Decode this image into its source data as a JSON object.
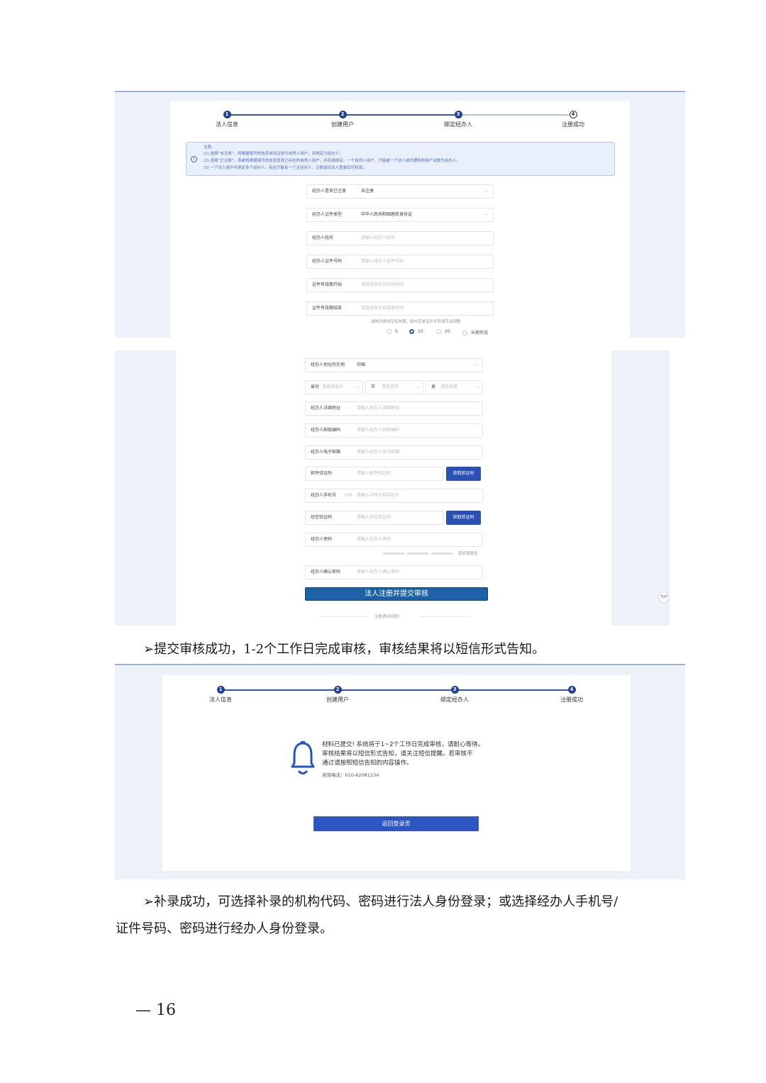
{
  "steps": [
    "法人信息",
    "创建用户",
    "绑定经办人",
    "注册成功"
  ],
  "step_numbers": [
    "1",
    "2",
    "3",
    "4"
  ],
  "notice": {
    "title": "注意:",
    "lines": [
      "(1) 选择“未注册”，将根据填写的信息自动注册为自然人用户，并绑定为经办人；",
      "(2) 选择“已注册”，系统将根据填写的信息查找已存在的自然人用户，并完成绑定。一个自然人用户，只能被一个法人或代理机构用户关联为经办人。",
      "(3) 一个法人用户可绑定多个经办人，有且只能有一个主经办人，注册成功法人登录后可修改。"
    ]
  },
  "form_top": [
    {
      "label": "经办人是否已注册",
      "value": "未注册",
      "select": true
    },
    {
      "label": "经办人证件类型",
      "value": "中华人民共和国居民身份证",
      "select": true
    },
    {
      "label": "经办人姓名",
      "placeholder": "请输入经办人姓名"
    },
    {
      "label": "经办人证件号码",
      "placeholder": "请输入经办人证件号码"
    },
    {
      "label": "证件有效期开始",
      "placeholder": "请选择身份证开始时间"
    },
    {
      "label": "证件有效期结束",
      "placeholder": "请选择身份证结束时间"
    }
  ],
  "validity_hint": "请核对身份证有效期，如与实体证件不符请手动调整",
  "validity_options": [
    "5",
    "10",
    "20",
    "长期有效"
  ],
  "form_bottom": {
    "address_country": {
      "label": "经办人地址所在地",
      "value": "中国"
    },
    "province": {
      "label": "省份",
      "placeholder": "请选择省份"
    },
    "city": {
      "label": "市",
      "placeholder": "请选择市"
    },
    "county": {
      "label": "县",
      "placeholder": "请选择县"
    },
    "detail_address": {
      "label": "经办人详细地址",
      "placeholder": "请输入经办人详细地址"
    },
    "postcode": {
      "label": "经办人邮政编码",
      "placeholder": "请输入经办人邮政编码"
    },
    "email": {
      "label": "经办人电子邮箱",
      "placeholder": "请输入经办人电子邮箱"
    },
    "email_code": {
      "label": "邮件验证码",
      "placeholder": "请输入邮件验证码"
    },
    "mobile": {
      "label": "经办人手机号",
      "prefix": "+86",
      "placeholder": "请输入中国大陆手机号"
    },
    "sms_code": {
      "label": "短信验证码",
      "placeholder": "请输入短信验证码"
    },
    "password": {
      "label": "经办人密码",
      "placeholder": "请输入经办人密码"
    },
    "password_strength": "密码强度低",
    "confirm_password": {
      "label": "经办人确认密码",
      "placeholder": "请输入经办人确认密码"
    },
    "get_code_label": "获取验证码",
    "submit": "法人注册并提交审核",
    "help": "注册遇到问题?",
    "top_button": "TOP"
  },
  "para1": "➢提交审核成功，1-2个工作日完成审核，审核结果将以短信形式告知。",
  "success": {
    "line1": "材料已提交! 系统将于1~2个工作日完成审核，请耐心等待。",
    "line2": "审核结果将以短信形式告知，请关注短信提醒。若审核不",
    "line3": "通过请按照短信告知的内容操作。",
    "consult": "咨询电话：010-62081234",
    "back_button": "返回登录页"
  },
  "para2_line1": "➢补录成功，可选择补录的机构代码、密码进行法人身份登录；或选择经办人手机号/",
  "para2_line2": "证件号码、密码进行经办人身份登录。",
  "footer": "—  16"
}
